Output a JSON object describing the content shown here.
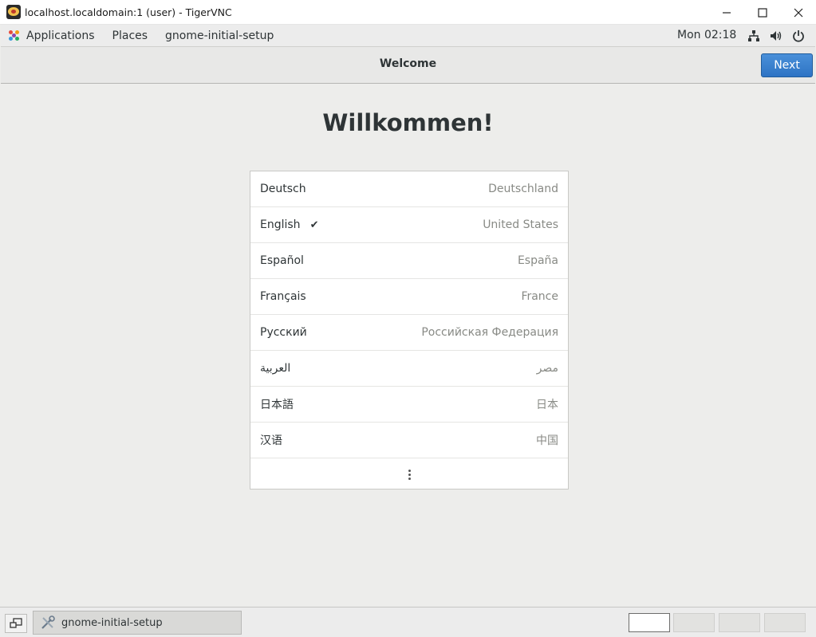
{
  "window": {
    "title": "localhost.localdomain:1 (user) - TigerVNC"
  },
  "top_panel": {
    "applications_label": "Applications",
    "places_label": "Places",
    "app_name": "gnome-initial-setup",
    "clock": "Mon 02:18"
  },
  "header": {
    "title": "Welcome",
    "next_label": "Next"
  },
  "main": {
    "heading": "Willkommen!",
    "languages": [
      {
        "name": "Deutsch",
        "region": "Deutschland",
        "selected": false
      },
      {
        "name": "English",
        "region": "United States",
        "selected": true
      },
      {
        "name": "Español",
        "region": "España",
        "selected": false
      },
      {
        "name": "Français",
        "region": "France",
        "selected": false
      },
      {
        "name": "Русский",
        "region": "Российская Федерация",
        "selected": false
      },
      {
        "name": "العربية",
        "region": "مصر",
        "selected": false
      },
      {
        "name": "日本語",
        "region": "日本",
        "selected": false
      },
      {
        "name": "汉语",
        "region": "中国",
        "selected": false
      }
    ],
    "checkmark": "✔"
  },
  "taskbar": {
    "task_label": "gnome-initial-setup",
    "workspaces": 4,
    "active_workspace": 1
  },
  "colors": {
    "accent": "#3584e4",
    "background": "#ededeb"
  }
}
